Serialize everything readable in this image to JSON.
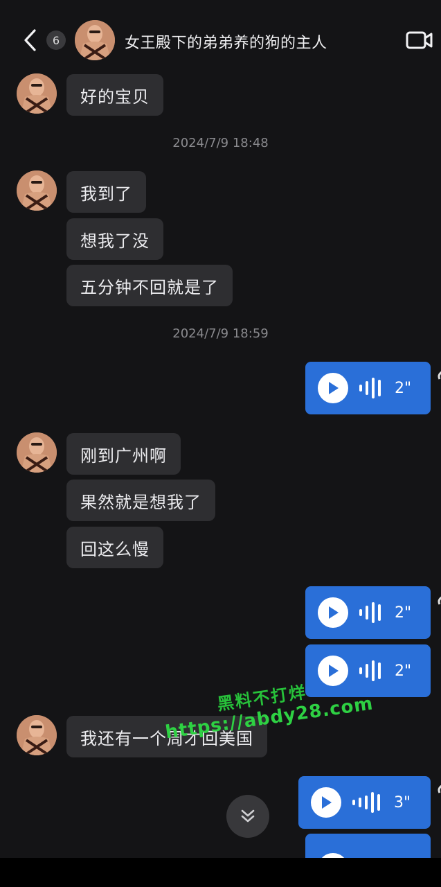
{
  "header": {
    "unread_count": "6",
    "title": "女王殿下的弟弟养的狗的主人"
  },
  "messages": {
    "m1": "好的宝贝",
    "ts1": "2024/7/9 18:48",
    "m2": "我到了",
    "m3": "想我了没",
    "m4": "五分钟不回就是了",
    "ts2": "2024/7/9 18:59",
    "v1_duration": "2\"",
    "m5": "刚到广州啊",
    "m6": "果然就是想我了",
    "m7": "回这么慢",
    "v2_duration": "2\"",
    "v3_duration": "2\"",
    "m8": "我还有一个周才回美国",
    "v4_duration": "3\""
  },
  "watermark": {
    "line1": "黑料不打烊",
    "line2": "https://abdy28.com"
  },
  "icons": {
    "back": "chevron-left-icon",
    "video": "video-camera-icon",
    "play": "play-icon",
    "waveform": "waveform-icon",
    "scroll": "double-chevron-down-icon"
  },
  "colors": {
    "background": "#141416",
    "incoming_bubble": "#2e2e31",
    "outgoing_voice": "#2a6fd8",
    "watermark": "#2ed143"
  }
}
